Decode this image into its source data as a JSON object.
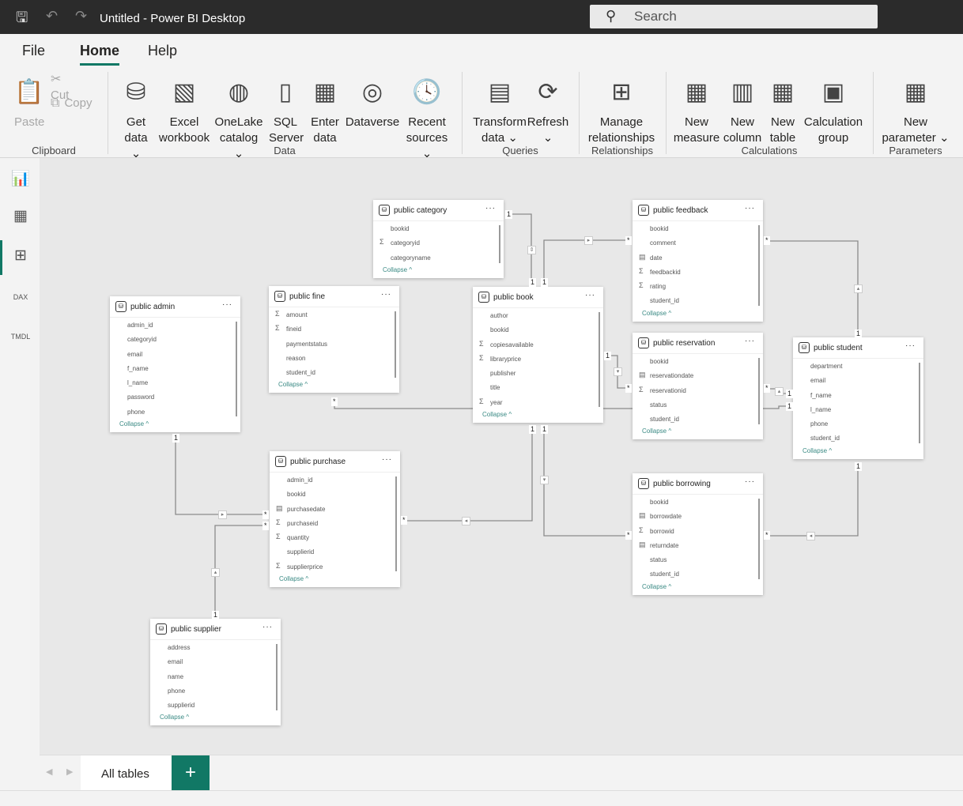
{
  "titlebar": {
    "title": "Untitled - Power BI Desktop",
    "search_placeholder": "Search"
  },
  "menu_tabs": [
    {
      "label": "File"
    },
    {
      "label": "Home",
      "active": true
    },
    {
      "label": "Help"
    }
  ],
  "ribbon": {
    "buttons": [
      {
        "id": "paste",
        "label": "Paste",
        "icon": "📋",
        "disabled": true
      },
      {
        "id": "cut",
        "label": "Cut",
        "icon": "✂",
        "disabled": true
      },
      {
        "id": "copy",
        "label": "Copy",
        "icon": "⧉",
        "disabled": true
      },
      {
        "id": "get-data",
        "label": "Get\ndata ⌄",
        "icon": "⛁"
      },
      {
        "id": "excel-workbook",
        "label": "Excel\nworkbook",
        "icon": "▧"
      },
      {
        "id": "onelake-catalog",
        "label": "OneLake\ncatalog ⌄",
        "icon": "◍"
      },
      {
        "id": "sql-server",
        "label": "SQL\nServer",
        "icon": "▯"
      },
      {
        "id": "enter-data",
        "label": "Enter\ndata",
        "icon": "▦"
      },
      {
        "id": "dataverse",
        "label": "Dataverse",
        "icon": "◎"
      },
      {
        "id": "recent-sources",
        "label": "Recent\nsources ⌄",
        "icon": "🕓"
      },
      {
        "id": "transform-data",
        "label": "Transform\ndata ⌄",
        "icon": "▤"
      },
      {
        "id": "refresh",
        "label": "Refresh\n⌄",
        "icon": "⟳"
      },
      {
        "id": "manage-relationships",
        "label": "Manage\nrelationships",
        "icon": "⊞"
      },
      {
        "id": "new-measure",
        "label": "New\nmeasure",
        "icon": "▦"
      },
      {
        "id": "new-column",
        "label": "New\ncolumn",
        "icon": "▥"
      },
      {
        "id": "new-table",
        "label": "New\ntable",
        "icon": "▦"
      },
      {
        "id": "calculation-group",
        "label": "Calculation\ngroup",
        "icon": "▣"
      },
      {
        "id": "new-parameter",
        "label": "New\nparameter ⌄",
        "icon": "▦"
      }
    ],
    "groups": [
      "Clipboard",
      "Data",
      "Queries",
      "Relationships",
      "Calculations",
      "Parameters"
    ]
  },
  "left_nav": [
    "report-view",
    "table-view",
    "model-view",
    "dax-query-view",
    "tmdl-view"
  ],
  "rel": {
    "one": "1",
    "many": "*"
  },
  "tables": [
    {
      "name": "public category",
      "fields": [
        [
          "",
          "bookid"
        ],
        [
          "sum",
          "categoryid"
        ],
        [
          "",
          "categoryname"
        ]
      ]
    },
    {
      "name": "public feedback",
      "fields": [
        [
          "",
          "bookid"
        ],
        [
          "",
          "comment"
        ],
        [
          "cal",
          "date"
        ],
        [
          "sum",
          "feedbackid"
        ],
        [
          "sum",
          "rating"
        ],
        [
          "",
          "student_id"
        ]
      ]
    },
    {
      "name": "public admin",
      "fields": [
        [
          "",
          "admin_id"
        ],
        [
          "",
          "categoryid"
        ],
        [
          "",
          "email"
        ],
        [
          "",
          "f_name"
        ],
        [
          "",
          "l_name"
        ],
        [
          "",
          "password"
        ],
        [
          "",
          "phone"
        ]
      ]
    },
    {
      "name": "public fine",
      "fields": [
        [
          "sum",
          "amount"
        ],
        [
          "sum",
          "fineid"
        ],
        [
          "",
          "paymentstatus"
        ],
        [
          "",
          "reason"
        ],
        [
          "",
          "student_id"
        ]
      ]
    },
    {
      "name": "public book",
      "fields": [
        [
          "",
          "author"
        ],
        [
          "",
          "bookid"
        ],
        [
          "sum",
          "copiesavailable"
        ],
        [
          "sum",
          "libraryprice"
        ],
        [
          "",
          "publisher"
        ],
        [
          "",
          "title"
        ],
        [
          "sum",
          "year"
        ]
      ]
    },
    {
      "name": "public reservation",
      "fields": [
        [
          "",
          "bookid"
        ],
        [
          "cal",
          "reservationdate"
        ],
        [
          "sum",
          "reservationid"
        ],
        [
          "",
          "status"
        ],
        [
          "",
          "student_id"
        ]
      ]
    },
    {
      "name": "public student",
      "fields": [
        [
          "",
          "department"
        ],
        [
          "",
          "email"
        ],
        [
          "",
          "f_name"
        ],
        [
          "",
          "l_name"
        ],
        [
          "",
          "phone"
        ],
        [
          "",
          "student_id"
        ]
      ]
    },
    {
      "name": "public purchase",
      "fields": [
        [
          "",
          "admin_id"
        ],
        [
          "",
          "bookid"
        ],
        [
          "cal",
          "purchasedate"
        ],
        [
          "sum",
          "purchaseid"
        ],
        [
          "sum",
          "quantity"
        ],
        [
          "",
          "supplierid"
        ],
        [
          "sum",
          "supplierprice"
        ]
      ]
    },
    {
      "name": "public borrowing",
      "fields": [
        [
          "",
          "bookid"
        ],
        [
          "cal",
          "borrowdate"
        ],
        [
          "sum",
          "borrowid"
        ],
        [
          "cal",
          "returndate"
        ],
        [
          "",
          "status"
        ],
        [
          "",
          "student_id"
        ]
      ]
    },
    {
      "name": "public supplier",
      "fields": [
        [
          "",
          "address"
        ],
        [
          "",
          "email"
        ],
        [
          "",
          "name"
        ],
        [
          "",
          "phone"
        ],
        [
          "",
          "supplierid"
        ]
      ]
    }
  ],
  "collapse_label": "Collapse",
  "more_label": "···",
  "bottom": {
    "tab_label": "All tables",
    "add_label": "+"
  }
}
